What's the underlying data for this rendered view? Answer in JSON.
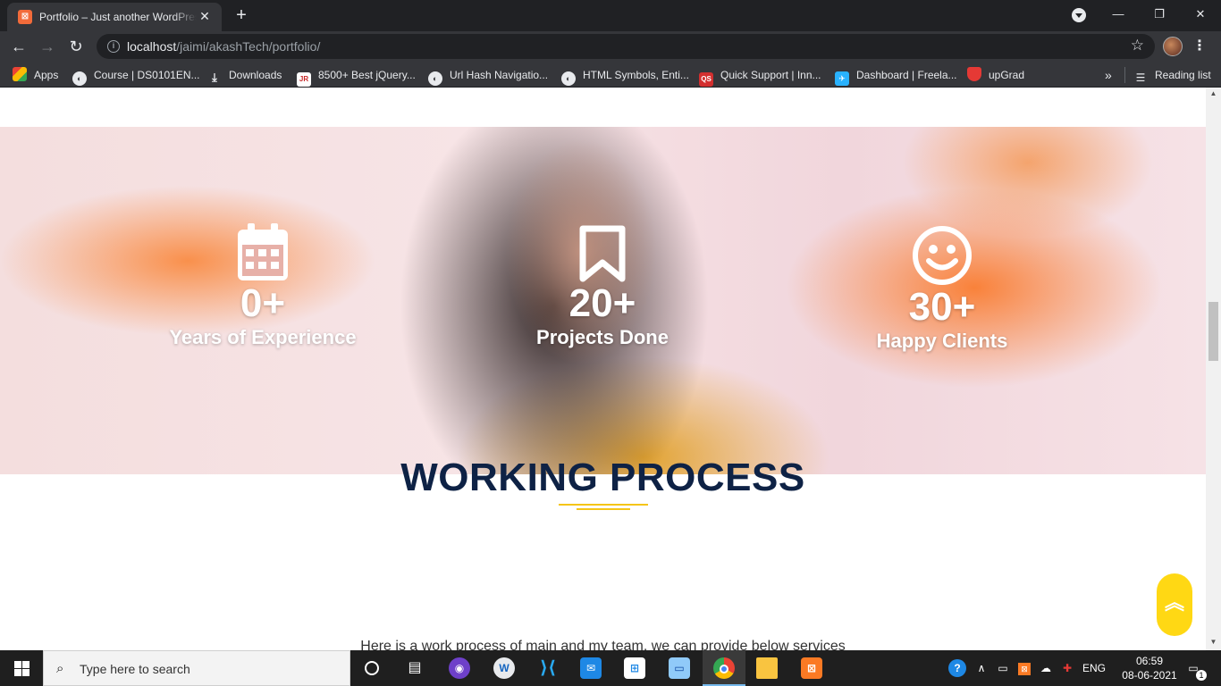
{
  "browser": {
    "tab_title": "Portfolio – Just another WordPress site",
    "tab_close": "✕",
    "new_tab": "+",
    "url_host": "localhost",
    "url_path": "/jaimi/akashTech/portfolio/",
    "bookmarks": [
      {
        "label": "Apps",
        "icon": "apps-grid-icon"
      },
      {
        "label": "Course | DS0101EN...",
        "icon": "globe-icon"
      },
      {
        "label": "Downloads",
        "icon": "download-icon"
      },
      {
        "label": "8500+ Best jQuery...",
        "icon": "jr-icon"
      },
      {
        "label": "Url Hash Navigatio...",
        "icon": "globe-icon"
      },
      {
        "label": "HTML Symbols, Enti...",
        "icon": "globe-icon"
      },
      {
        "label": "Quick Support | Inn...",
        "icon": "support-icon"
      },
      {
        "label": "Dashboard | Freela...",
        "icon": "freelancer-icon"
      },
      {
        "label": "upGrad",
        "icon": "upgrad-icon"
      }
    ],
    "bookmarks_overflow": "»",
    "reading_list": "Reading list"
  },
  "stats": [
    {
      "icon": "calendar-icon",
      "value": "0+",
      "label": "Years of Experience"
    },
    {
      "icon": "bookmark-icon",
      "value": "20+",
      "label": "Projects Done"
    },
    {
      "icon": "smile-icon",
      "value": "30+",
      "label": "Happy Clients"
    }
  ],
  "working_process": {
    "title": "WORKING PROCESS",
    "description": "Here is a work process of main and my team, we can provide below services"
  },
  "back_to_top": "⌃",
  "taskbar": {
    "search_placeholder": "Type here to search",
    "language": "ENG",
    "time": "06:59",
    "date": "08-06-2021",
    "notification_count": "1"
  },
  "colors": {
    "title_navy": "#0e2245",
    "accent_yellow": "#ffd814",
    "chrome_dark": "#202124",
    "chrome_mid": "#35363a"
  }
}
